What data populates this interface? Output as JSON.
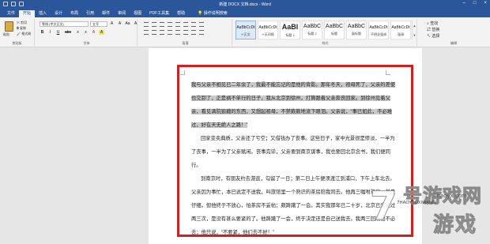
{
  "window": {
    "title": "新建 DOCX 文档.docx - Word"
  },
  "tabs": [
    {
      "label": "文件",
      "active": false
    },
    {
      "label": "开始",
      "active": true
    },
    {
      "label": "插入",
      "active": false
    },
    {
      "label": "设计",
      "active": false
    },
    {
      "label": "布局",
      "active": false
    },
    {
      "label": "引用",
      "active": false
    },
    {
      "label": "邮件",
      "active": false
    },
    {
      "label": "审阅",
      "active": false
    },
    {
      "label": "视图",
      "active": false
    },
    {
      "label": "PDF工具集",
      "active": false
    },
    {
      "label": "帮助",
      "active": false
    }
  ],
  "tell_me": "操作说明搜索",
  "ribbon": {
    "clipboard": {
      "paste": "粘贴",
      "cut": "剪切",
      "copy": "复制",
      "format_painter": "格式刷",
      "label": "剪贴板"
    },
    "font": {
      "name": "等线 (中文正文)",
      "size": "五号",
      "label": "字体",
      "row1": [
        "A",
        "A",
        "Aa",
        "A",
        "A"
      ],
      "row2": [
        "B",
        "I",
        "U",
        "abc",
        "x",
        "x",
        "A",
        "A"
      ]
    },
    "paragraph": {
      "label": "段落"
    },
    "styles": {
      "label": "样式",
      "items": [
        {
          "sample": "AaBbCcDt",
          "name": "↵正文",
          "size": "normal"
        },
        {
          "sample": "AaBbCcDt",
          "name": "↵无间隔",
          "size": "normal"
        },
        {
          "sample": "AaBl",
          "name": "标题 1",
          "size": "big"
        },
        {
          "sample": "AaBbC",
          "name": "标题 2",
          "size": "mid"
        },
        {
          "sample": "AaBbC",
          "name": "标题",
          "size": "mid"
        },
        {
          "sample": "AaBbC",
          "name": "副标题",
          "size": "mid"
        },
        {
          "sample": "AaBbCcDt",
          "name": "不明显强调",
          "size": "normal"
        },
        {
          "sample": "AaBbCcDt",
          "name": "强调",
          "size": "normal"
        },
        {
          "sample": "AaBbCcDt",
          "name": "明显强调",
          "size": "normal"
        },
        {
          "sample": "AaBbCcDt",
          "name": "要点",
          "size": "normal"
        },
        {
          "sample": "AaBbCcDt",
          "name": "引用",
          "size": "normal"
        }
      ]
    },
    "editing": {
      "find": "查找",
      "replace": "替换",
      "select": "选择",
      "label": "编辑"
    }
  },
  "document": {
    "paragraphs": [
      {
        "highlight": "我与父亲不相见已二年余了，我最不能忘记的是他的背影。那年冬天，祖母死了，父亲的差使也交卸了，正是祸不单行的日子，我从北京到徐州，打算跟着父亲奔丧回家。到徐州见着父亲，看见满院狼藉的东西，又想起祖母，不禁簌簌地流下眼泪。父亲说，“事已如此，不必难过，好在天无绝人之路！”",
        "rest": ""
      },
      {
        "highlight": "",
        "rest": "回家变卖典质，父亲还了亏空；又借钱办了丧事。这些日子，家中光景很是惨淡，一半为了丧事，一半为了父亲赋闲。丧事完毕，父亲要到南京谋事，我也要回北京念书，我们便同行。"
      },
      {
        "highlight": "",
        "rest": "到南京时，有朋友约去游逛，勾留了一日；第二日上午便须渡江到浦口，下午上车北去。父亲因为事忙，本已说定不送我，叫旅馆里一个熟识的茶房陪我同去。他再三嘱咐茶房，甚是仔细。但他终于不放心，怕茶房不妥帖；颇踌躇了一会。其实我那年已二十岁，北京已来往过两三次，是没有甚么要紧的了。他踌躇了一会，终于决定还是自己送我去。我两三回劝他不必去；他只说，“不要紧，他们去不好！”"
      }
    ]
  },
  "watermark": {
    "digit": "7",
    "line1": "号游戏网",
    "line2": "游戏",
    "domain": "7haoyx.com",
    "pinyin": "7HAOYOUXIWANG"
  },
  "colors": {
    "accent": "#2b579a",
    "selection_box": "#d0201f",
    "text_highlight": "#c9c9c9"
  }
}
